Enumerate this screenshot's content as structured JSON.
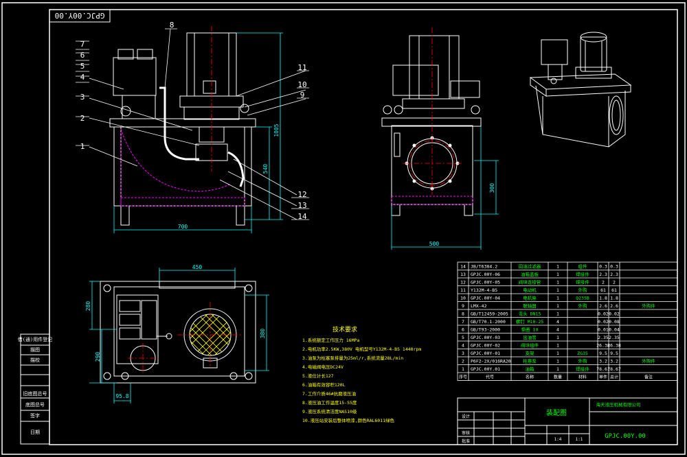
{
  "drawing_number": "GPJC.00Y.00",
  "drawing_number_rotated": "GPJC.00Y.00",
  "title_block": {
    "title": "装配图",
    "company": "海天液压机械有限公司",
    "scale": "1:4",
    "sheet": "1:1",
    "material_code": "GPJC.00Y.00",
    "label_design": "设计",
    "label_check": "审核",
    "label_approve": "批准",
    "header_row": [
      "序号",
      "代号",
      "名称",
      "数量",
      "材料",
      "单件",
      "总计",
      "备注"
    ]
  },
  "left_strip": [
    "借(通)用件登记",
    "描图",
    "描校",
    "旧底图总号",
    "底图总号",
    "签字",
    "日期"
  ],
  "front_view": {
    "callouts": [
      "1",
      "2",
      "3",
      "4",
      "5",
      "6",
      "7",
      "8",
      "9",
      "10",
      "11",
      "12",
      "13",
      "14"
    ],
    "width_dim": "700",
    "height_total": "1005",
    "height_tank": "540"
  },
  "side_view": {
    "width_dim": "500",
    "height_dim": "300"
  },
  "top_view": {
    "dim_top": "450",
    "dim_left_top": "280",
    "dim_left_bottom": "290",
    "dim_right": "380",
    "dim_bottom": "95.8"
  },
  "notes": {
    "heading": "技术要求",
    "items": [
      "1.系统额定工作压力 16MPa",
      "2.电机功率2.5KW,380V  电机型号Y132M-4-B5  1440rpm",
      "3.油泵为柱塞泵排量为25ml/r,系统流量28L/min",
      "4.电磁阀电压DC24V",
      "5.液位计长127",
      "6.油箱有效容积120L",
      "7.工作介质46#抗磨液压油",
      "8.液压油工作温度15-55度",
      "9.液压系统清洁度NAS10级",
      "10.液压站安装后整体喷漆,颜色RAL6011绿色"
    ]
  },
  "bom": [
    {
      "no": "14",
      "code": "JB/T6384.2",
      "name": "回油过滤器",
      "qty": "1",
      "mat": "组件",
      "unit": "0.3",
      "total": "0.3",
      "note": ""
    },
    {
      "no": "13",
      "code": "GPJC.00Y-06",
      "name": "油箱盖板",
      "qty": "1",
      "mat": "焊接件",
      "unit": "2.3",
      "total": "2.3",
      "note": ""
    },
    {
      "no": "12",
      "code": "GPJC.00Y-05",
      "name": "阀块连接管",
      "qty": "1",
      "mat": "焊接件",
      "unit": "2",
      "total": "2",
      "note": ""
    },
    {
      "no": "11",
      "code": "Y132M-4-B5",
      "name": "电动机",
      "qty": "1",
      "mat": "外购",
      "unit": "61",
      "total": "61",
      "note": ""
    },
    {
      "no": "10",
      "code": "GPJC.00Y-04",
      "name": "电机座",
      "qty": "1",
      "mat": "Q235B",
      "unit": "1.8",
      "total": "1.8",
      "note": ""
    },
    {
      "no": "9",
      "code": "LMX-42",
      "name": "联轴器",
      "qty": "1",
      "mat": "外购",
      "unit": "2.6",
      "total": "2.6",
      "note": "外购件"
    },
    {
      "no": "8",
      "code": "GB/T12459-2005",
      "name": "弯头 DN15",
      "qty": "1",
      "mat": "",
      "unit": "0.02",
      "total": "0.02",
      "note": ""
    },
    {
      "no": "7",
      "code": "GB/T70.1-2000",
      "name": "螺钉 M10-25",
      "qty": "4",
      "mat": "",
      "unit": "0.02",
      "total": "0.08",
      "note": ""
    },
    {
      "no": "6",
      "code": "GB/T93-2000",
      "name": "垫圈 10",
      "qty": "4",
      "mat": "",
      "unit": "0.01",
      "total": "0.04",
      "note": ""
    },
    {
      "no": "5",
      "code": "GPJC.00Y-03",
      "name": "出油管",
      "qty": "1",
      "mat": "",
      "unit": "2.35",
      "total": "2.35",
      "note": ""
    },
    {
      "no": "4",
      "code": "GPJC.00Y-02",
      "name": "阀块组件",
      "qty": "1",
      "mat": "",
      "unit": "26.38",
      "total": "26.38",
      "note": ""
    },
    {
      "no": "3",
      "code": "GPJC.00Y-01",
      "name": "支架",
      "qty": "1",
      "mat": "ZG35",
      "unit": "9.5",
      "total": "9.5",
      "note": ""
    },
    {
      "no": "2",
      "code": "P6F2-2X/016RA20",
      "name": "柱塞泵",
      "qty": "1",
      "mat": "外购",
      "unit": "3.2",
      "total": "3.2",
      "note": "外购件"
    },
    {
      "no": "1",
      "code": "GPJC.00Y.01",
      "name": "油箱",
      "qty": "1",
      "mat": "焊接件",
      "unit": "78.61",
      "total": "78.67",
      "note": ""
    }
  ],
  "colors": {
    "background": "#000000",
    "lines": "#ffffff",
    "dimensions": "#00ffff",
    "hidden": "#ff00ff",
    "center": "#ff0000",
    "fill_filter": "#ffff00"
  }
}
